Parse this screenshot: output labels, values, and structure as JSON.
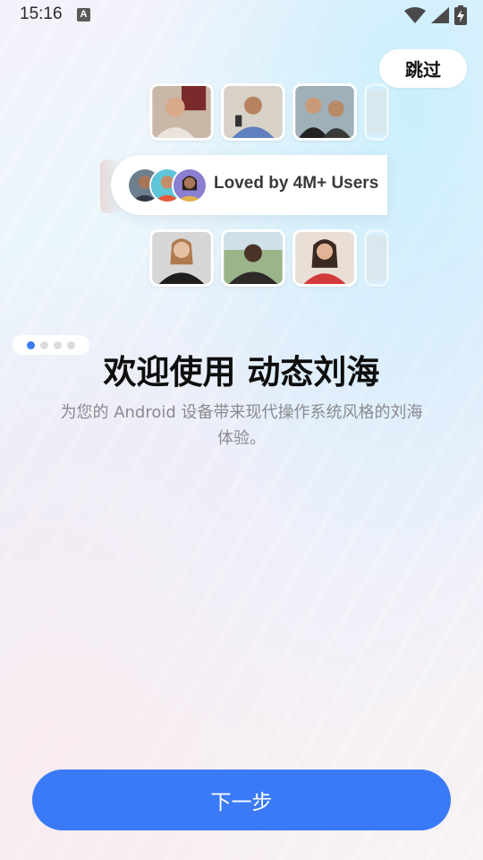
{
  "status_bar": {
    "time": "15:16",
    "icons": [
      "accessibility-a-icon",
      "wifi-icon",
      "signal-icon",
      "battery-charging-icon"
    ]
  },
  "skip": {
    "label": "跳过"
  },
  "social_proof": {
    "text": "Loved by 4M+ Users"
  },
  "pager": {
    "total": 4,
    "active": 1
  },
  "main": {
    "title": "欢迎使用 动态刘海",
    "subtitle": "为您的 Android 设备带来现代操作系统风格的刘海体验。"
  },
  "footer": {
    "next_label": "下一步"
  },
  "colors": {
    "accent": "#3a7af6",
    "dot_inactive": "#dcdcdc"
  }
}
